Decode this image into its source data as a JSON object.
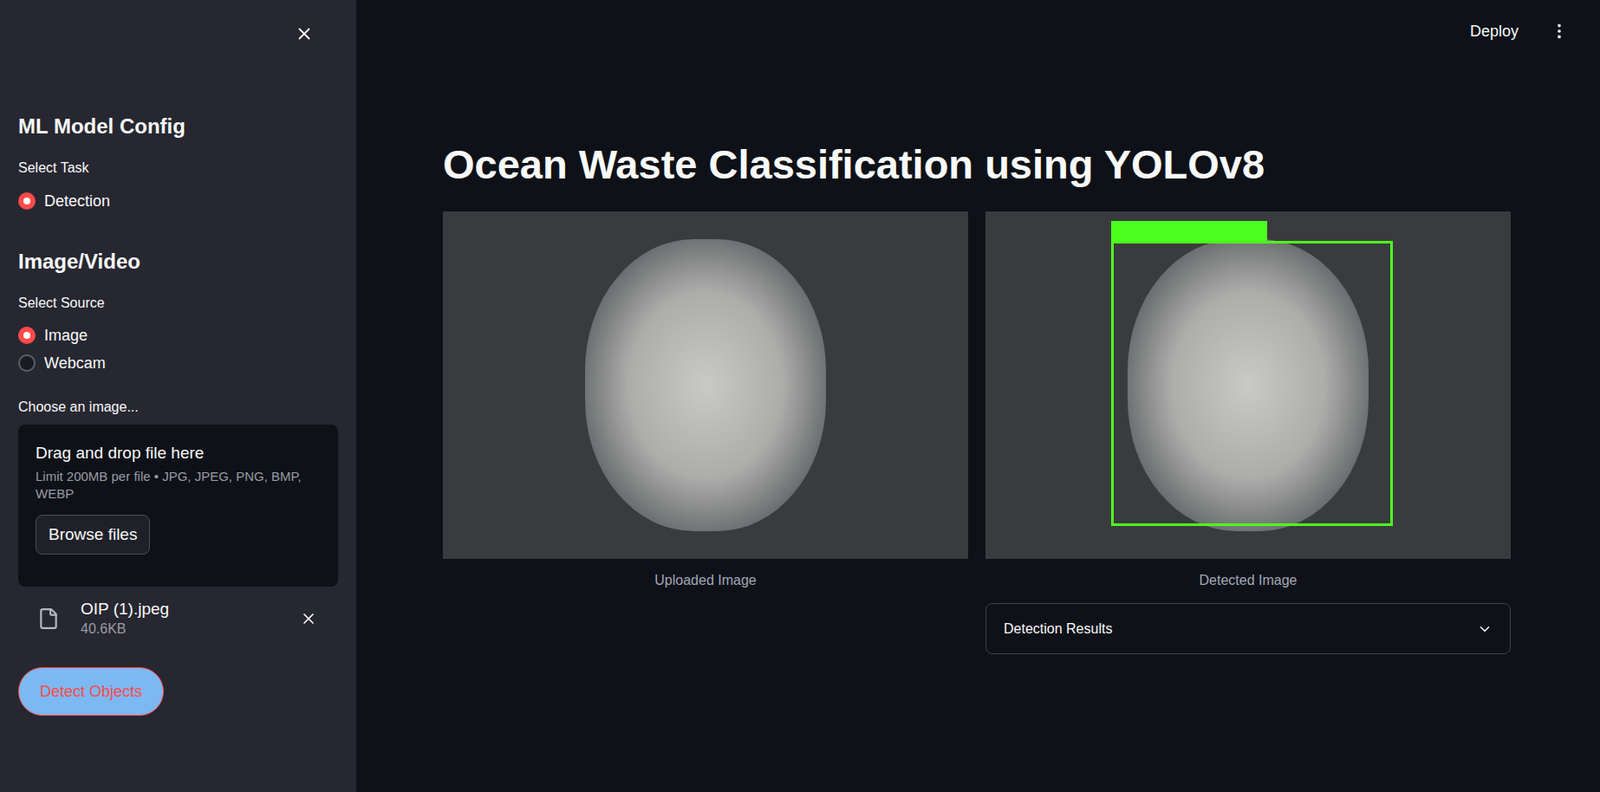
{
  "sidebar": {
    "sections": [
      {
        "title": "ML Model Config",
        "label": "Select Task",
        "options": [
          {
            "label": "Detection",
            "selected": true
          }
        ]
      },
      {
        "title": "Image/Video",
        "label": "Select Source",
        "options": [
          {
            "label": "Image",
            "selected": true
          },
          {
            "label": "Webcam",
            "selected": false
          }
        ]
      }
    ],
    "uploader": {
      "label": "Choose an image...",
      "drop_text": "Drag and drop file here",
      "limit": "Limit 200MB per file • JPG, JPEG, PNG, BMP, WEBP",
      "button": "Browse files",
      "file": {
        "name": "OIP (1).jpeg",
        "size": "40.6KB"
      }
    },
    "detect_button": "Detect Objects"
  },
  "header": {
    "deploy": "Deploy"
  },
  "title": "Ocean Waste Classification using YOLOv8",
  "images": [
    {
      "caption": "Uploaded Image",
      "detected": false
    },
    {
      "caption": "Detected Image",
      "detected": true
    }
  ],
  "expander": {
    "label": "Detection Results",
    "expanded": false
  }
}
